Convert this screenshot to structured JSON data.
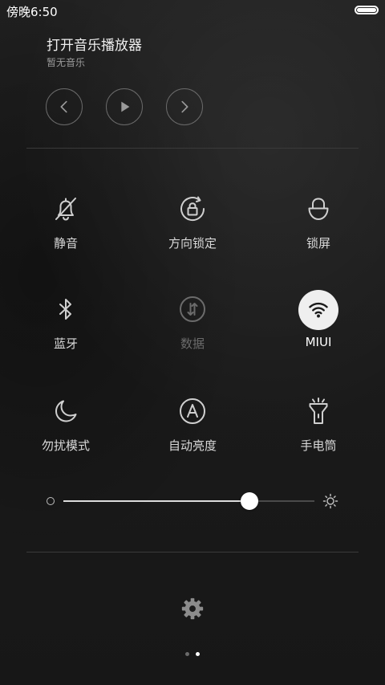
{
  "status_bar": {
    "time": "傍晚6:50",
    "battery_level": 1.0
  },
  "music": {
    "title": "打开音乐播放器",
    "subtitle": "暂无音乐",
    "controls": [
      "previous-icon",
      "play-icon",
      "next-icon"
    ]
  },
  "toggles": [
    {
      "label": "静音",
      "icon": "bell-off-icon",
      "state": "off"
    },
    {
      "label": "方向锁定",
      "icon": "rotation-lock-icon",
      "state": "off"
    },
    {
      "label": "锁屏",
      "icon": "lock-icon",
      "state": "off"
    },
    {
      "label": "蓝牙",
      "icon": "bluetooth-icon",
      "state": "off"
    },
    {
      "label": "数据",
      "icon": "mobile-data-icon",
      "state": "disabled"
    },
    {
      "label": "MIUI",
      "icon": "wifi-icon",
      "state": "on"
    },
    {
      "label": "勿扰模式",
      "icon": "moon-icon",
      "state": "off"
    },
    {
      "label": "自动亮度",
      "icon": "auto-brightness-icon",
      "state": "off"
    },
    {
      "label": "手电筒",
      "icon": "flashlight-icon",
      "state": "off"
    }
  ],
  "brightness": {
    "level": 0.74
  },
  "settings": {
    "icon": "gear-icon"
  },
  "pagination": {
    "total": 2,
    "current": 2
  },
  "colors": {
    "active_tile_bg": "#efefef",
    "icon_default": "#cfcfcf",
    "icon_disabled": "#6b6b6b"
  }
}
